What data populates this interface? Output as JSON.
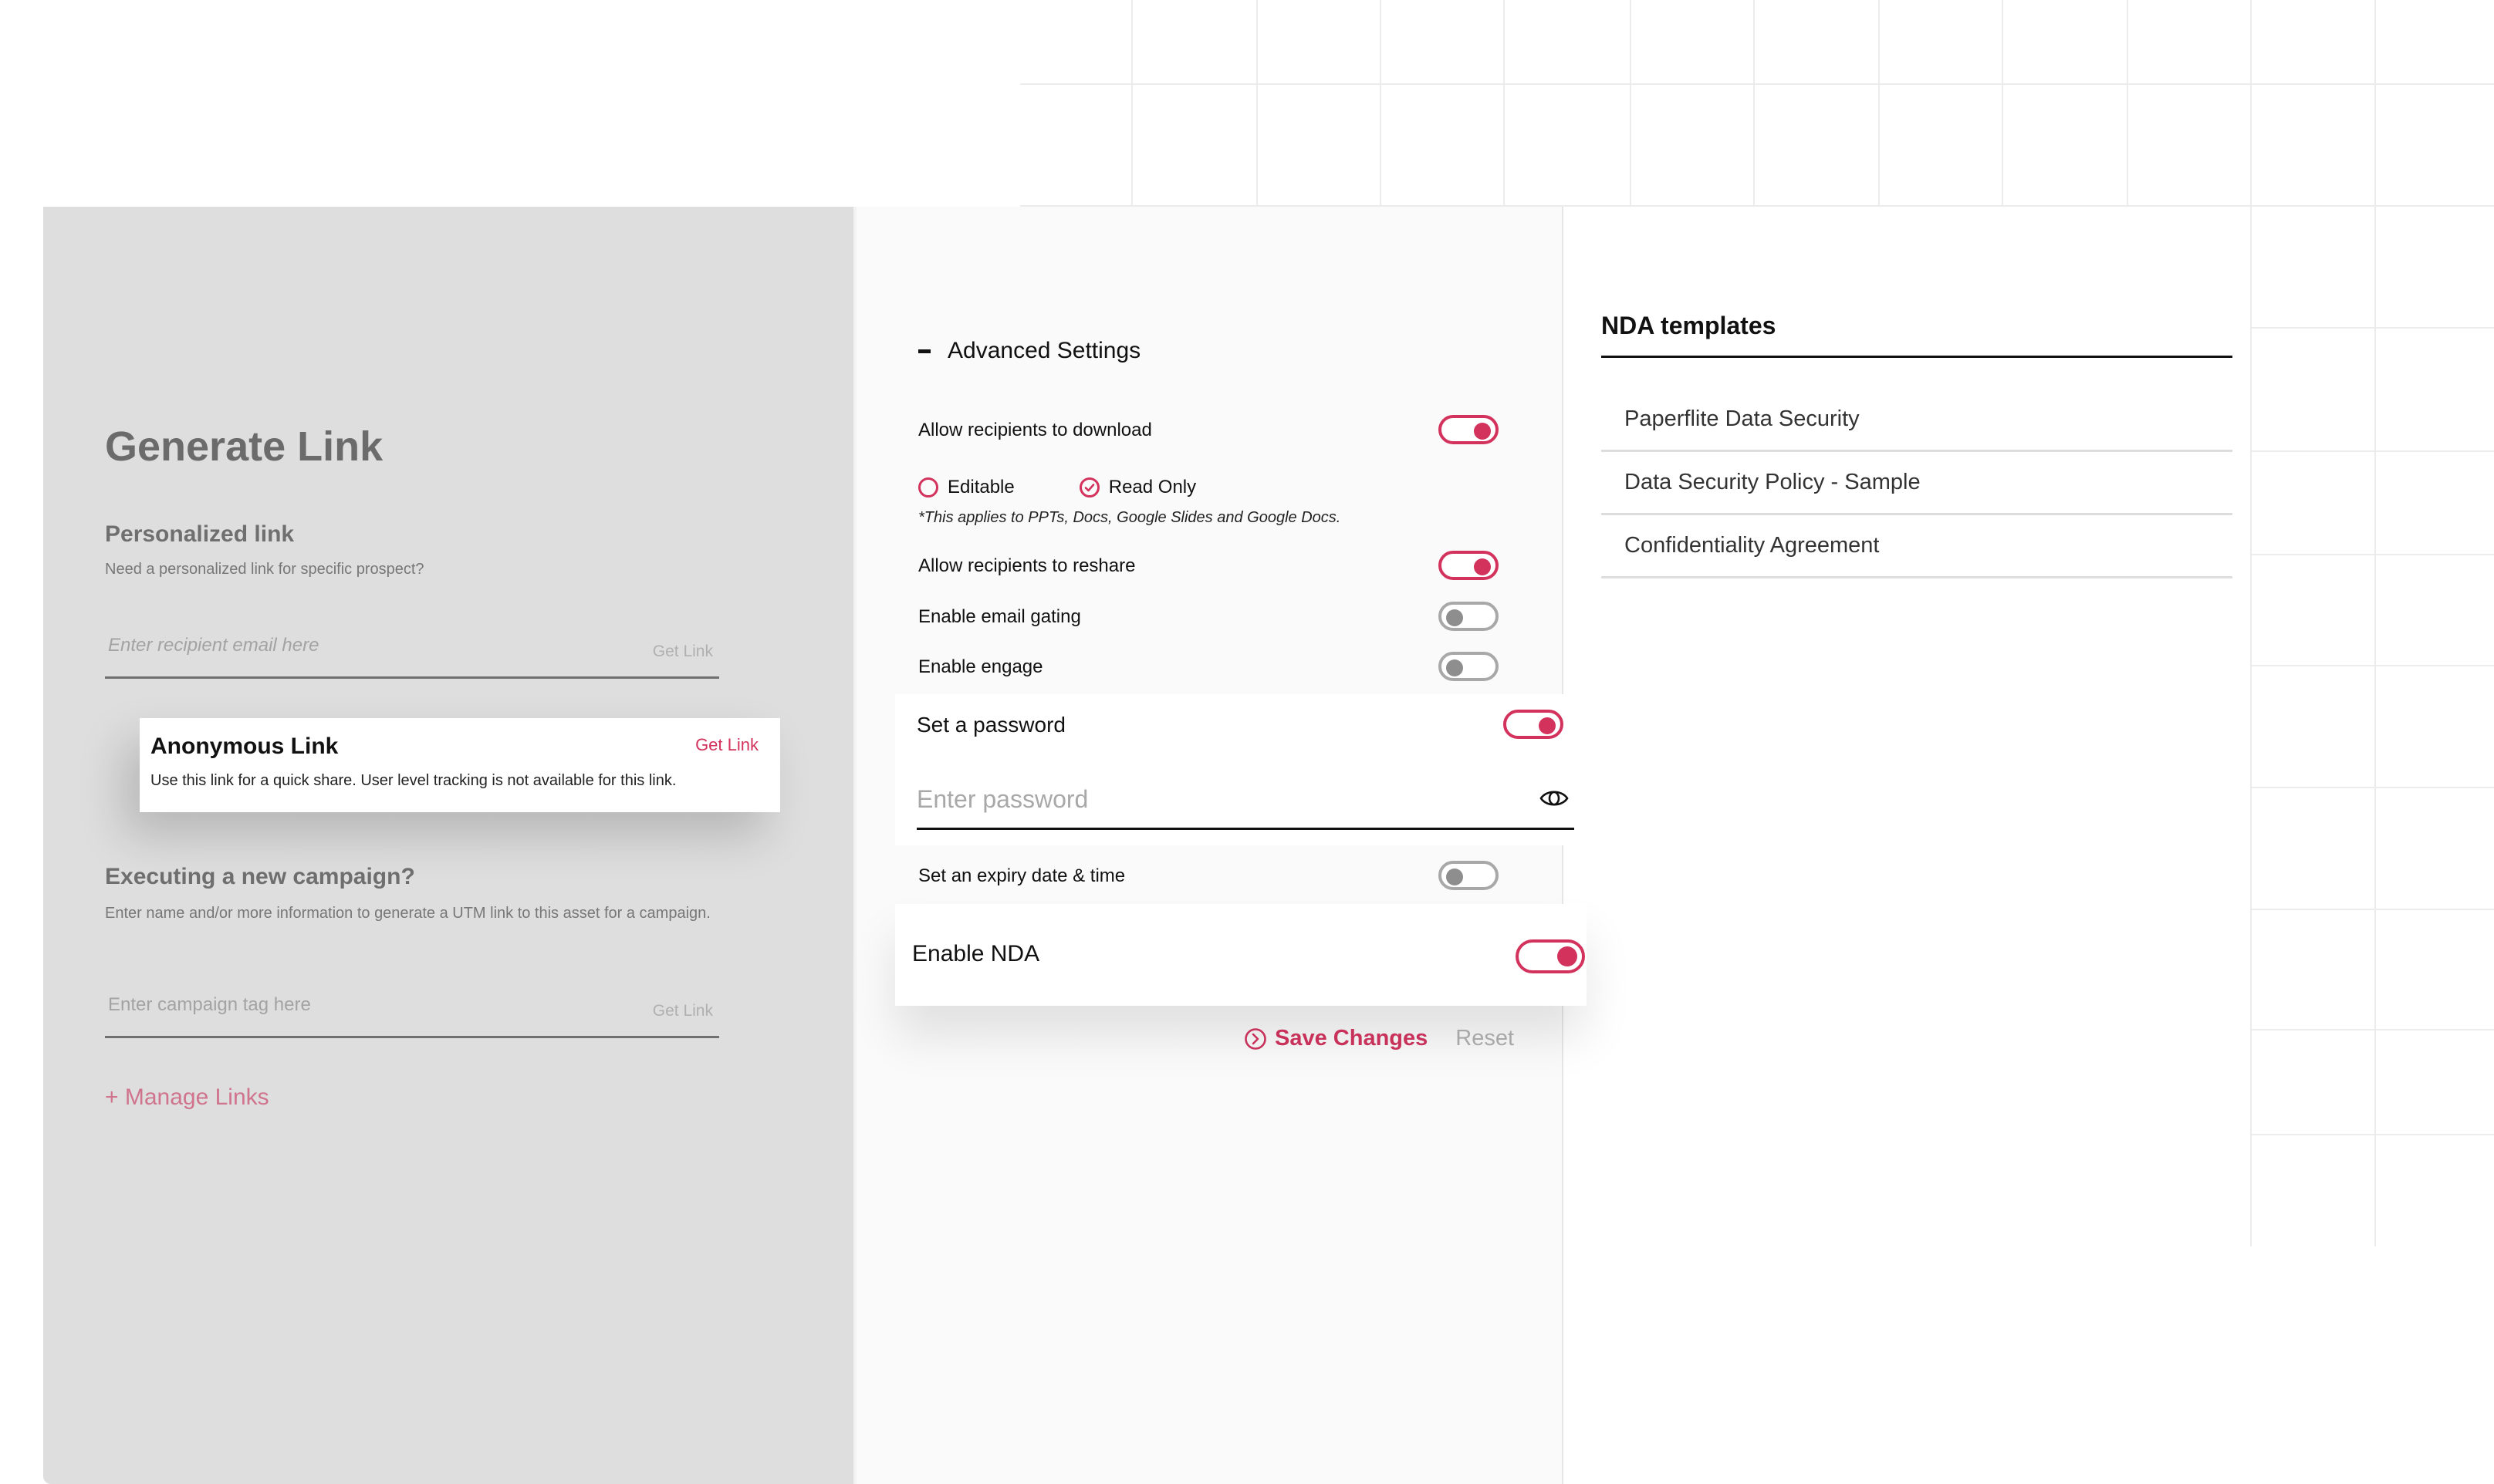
{
  "generate_link": {
    "title": "Generate Link",
    "personalized": {
      "title": "Personalized link",
      "description": "Need a personalized link for specific prospect?",
      "placeholder": "Enter recipient email here",
      "get_link": "Get Link"
    },
    "anonymous": {
      "title": "Anonymous Link",
      "get_link": "Get Link",
      "description": "Use this link for a quick share. User level tracking is not available for this link."
    },
    "campaign": {
      "title": "Executing a new campaign?",
      "description": "Enter name and/or more information to generate a UTM link to this asset for a campaign.",
      "placeholder": "Enter campaign tag here",
      "get_link": "Get Link"
    },
    "manage_links": "+ Manage Links"
  },
  "advanced_settings": {
    "title": "Advanced Settings",
    "download": {
      "label": "Allow recipients to download",
      "enabled": true
    },
    "permission": {
      "options": [
        {
          "label": "Editable",
          "selected": false
        },
        {
          "label": "Read Only",
          "selected": true
        }
      ],
      "note": "*This applies to PPTs, Docs, Google Slides and Google Docs."
    },
    "reshare": {
      "label": "Allow recipients to reshare",
      "enabled": true
    },
    "email_gating": {
      "label": "Enable email gating",
      "enabled": false
    },
    "engage": {
      "label": "Enable engage",
      "enabled": false
    },
    "password": {
      "label": "Set a password",
      "enabled": true,
      "placeholder": "Enter password"
    },
    "expiry": {
      "label": "Set an expiry date & time",
      "enabled": false
    },
    "nda": {
      "label": "Enable NDA",
      "enabled": true
    },
    "save_label": "Save Changes",
    "reset_label": "Reset"
  },
  "nda_templates": {
    "title": "NDA templates",
    "items": [
      "Paperflite Data Security",
      "Data Security Policy - Sample",
      "Confidentiality Agreement"
    ]
  },
  "colors": {
    "accent": "#D3325C",
    "toggle_off": "#A8A8A8",
    "left_panel_bg": "#DEDEDE",
    "mid_panel_bg": "#FAFAFA"
  }
}
